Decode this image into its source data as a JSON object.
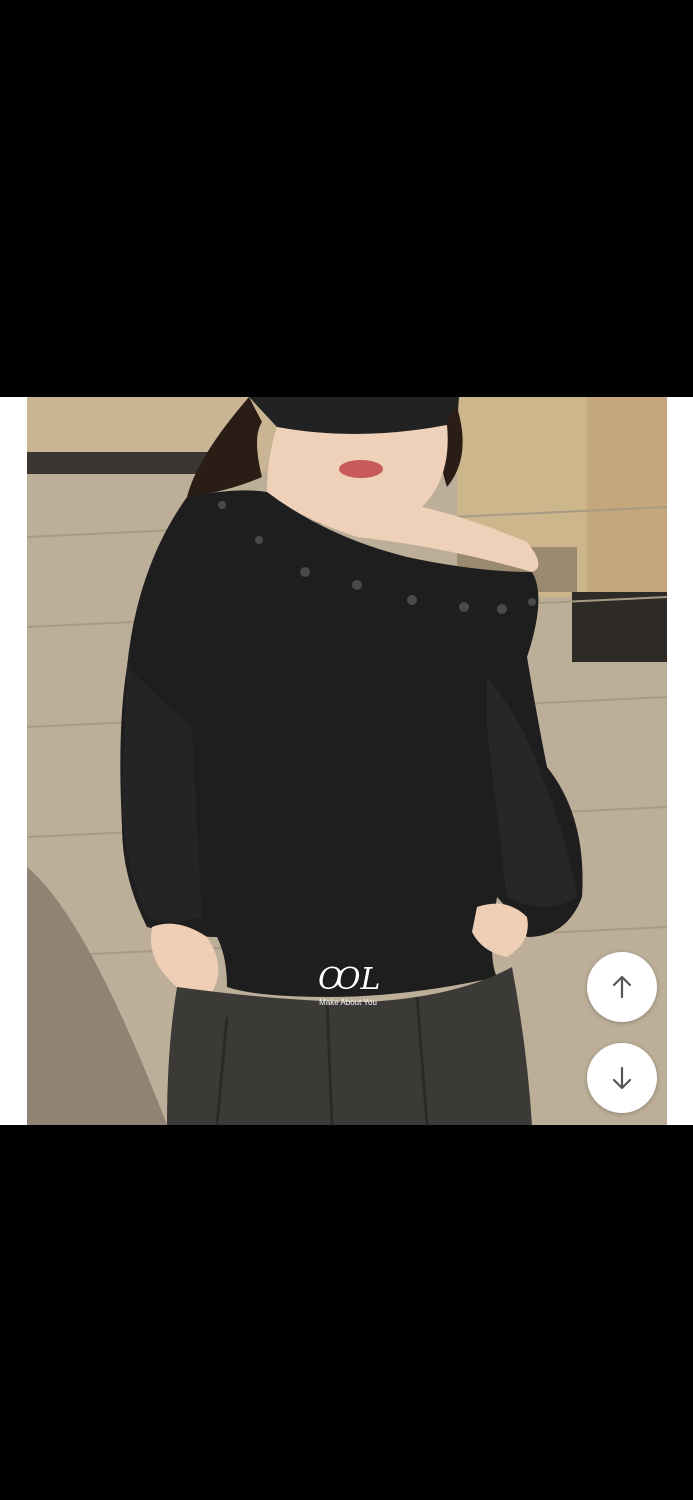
{
  "viewer": {
    "background": "#000000"
  },
  "image": {
    "alt": "Model wearing a black off-shoulder studded long-sleeve top with dark washed jeans and a black cap",
    "watermark": {
      "monogram": "ꝎL",
      "text": "Make About You"
    }
  },
  "controls": {
    "up_icon": "arrow-up-icon",
    "down_icon": "arrow-down-icon",
    "button_color": "#ffffff",
    "icon_color": "#555555"
  }
}
